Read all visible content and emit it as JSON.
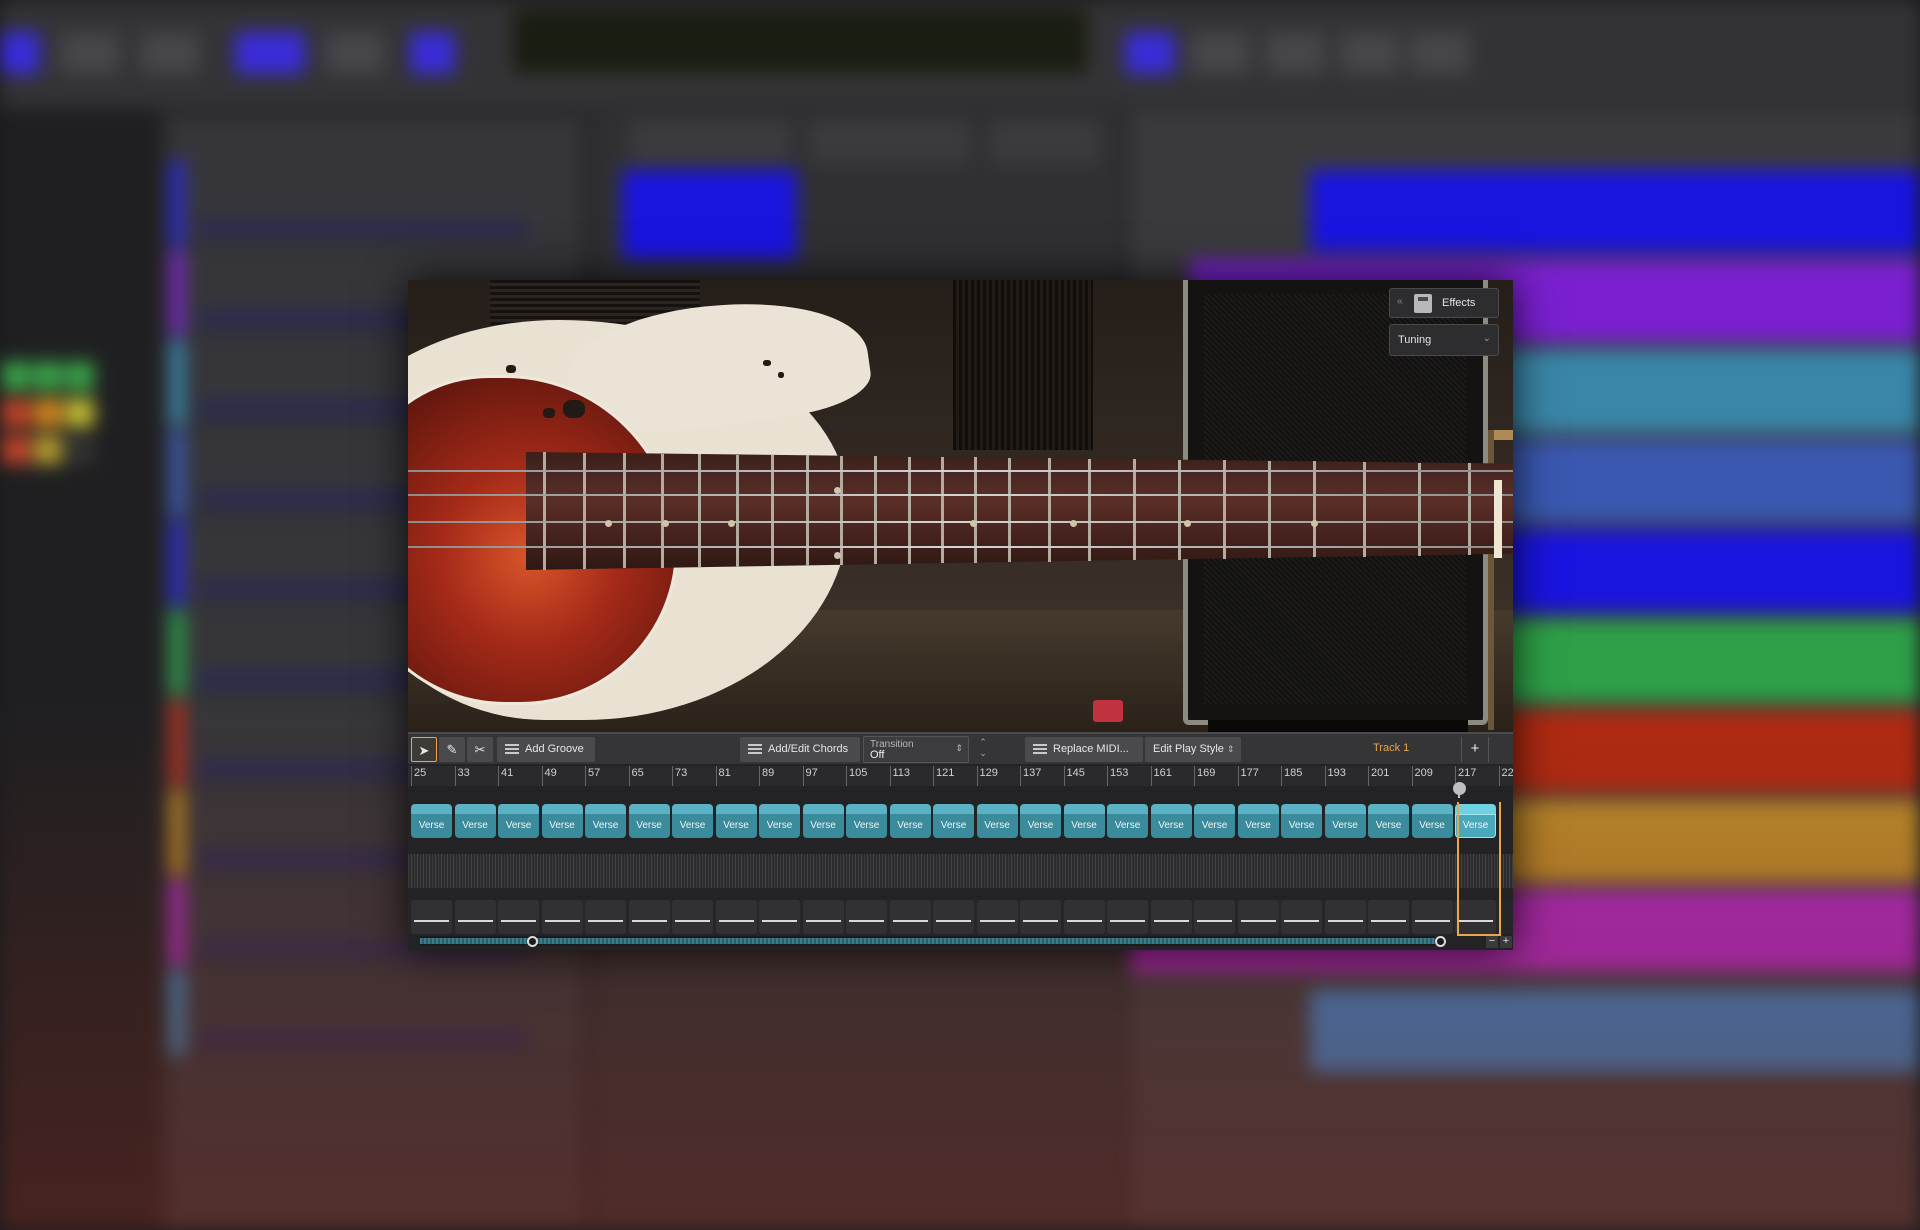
{
  "plugin": {
    "effects_label": "Effects",
    "tuning_label": "Tuning",
    "tools": {
      "add_groove": "Add Groove",
      "add_edit_chords": "Add/Edit Chords",
      "transition_label": "Transition",
      "transition_value": "Off",
      "replace_midi": "Replace MIDI...",
      "edit_play_style": "Edit Play Style"
    },
    "track_name": "Track 1",
    "ruler_ticks": [
      "25",
      "33",
      "41",
      "49",
      "57",
      "65",
      "73",
      "81",
      "89",
      "97",
      "105",
      "113",
      "121",
      "129",
      "137",
      "145",
      "153",
      "161",
      "169",
      "177",
      "185",
      "193",
      "201",
      "209",
      "217",
      "22"
    ],
    "part_label": "Verse",
    "part_count": 25,
    "selected_part_index": 24,
    "accent_color": "#e9a64a",
    "part_color": "#3a8b9c"
  }
}
